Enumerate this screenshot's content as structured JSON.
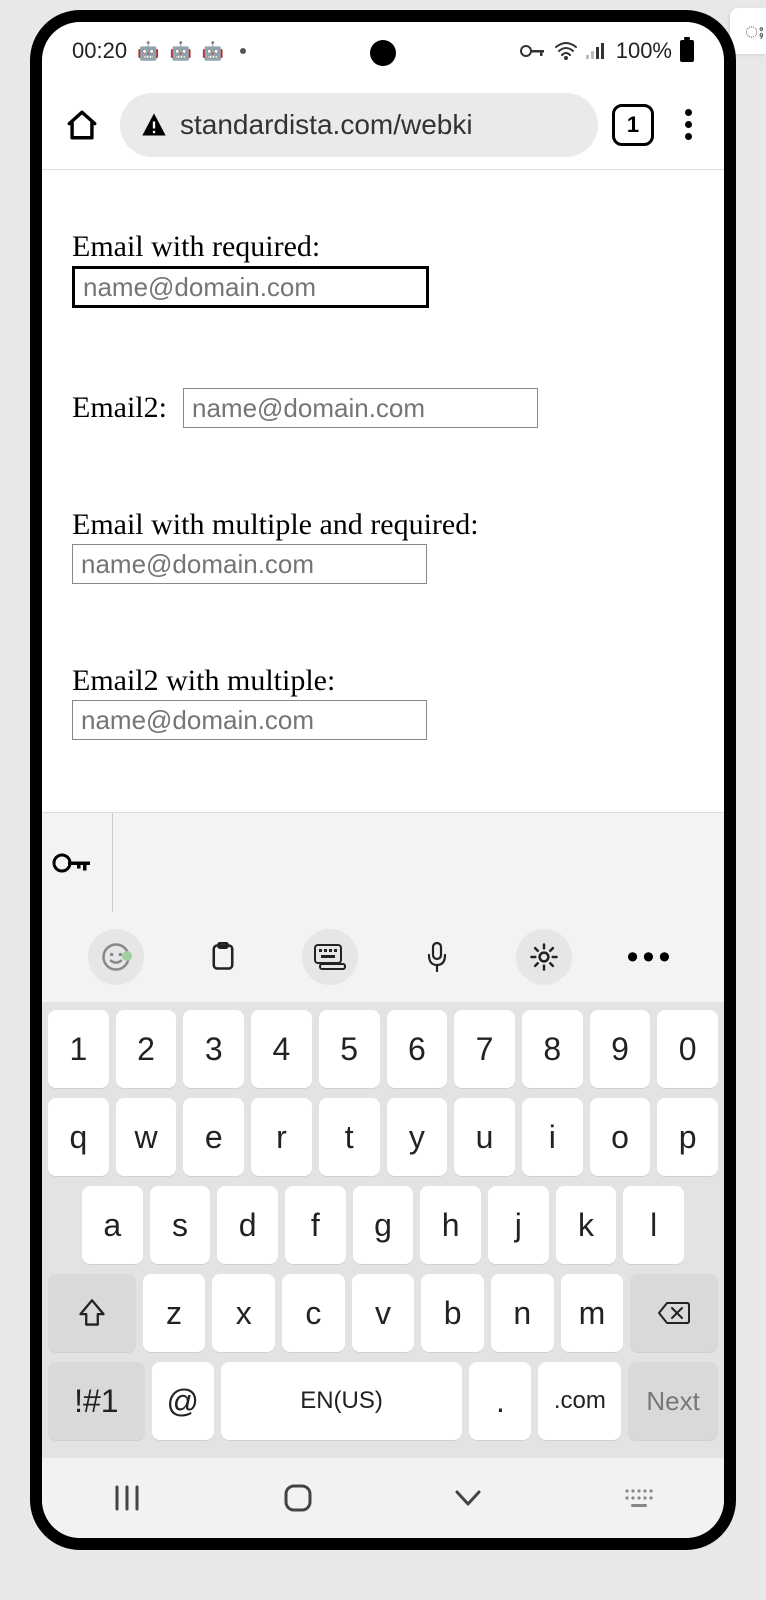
{
  "status": {
    "time": "00:20",
    "battery_pct": "100%"
  },
  "browser": {
    "url_visible": "standardista.com/webki",
    "tab_count": "1"
  },
  "form": {
    "fields": [
      {
        "label": "Email with required:",
        "placeholder": "name@domain.com",
        "focused": true,
        "layout": "block"
      },
      {
        "label": "Email2:",
        "placeholder": "name@domain.com",
        "focused": false,
        "layout": "inline"
      },
      {
        "label": "Email with multiple and required:",
        "placeholder": "name@domain.com",
        "focused": false,
        "layout": "block"
      },
      {
        "label": "Email2 with multiple:",
        "placeholder": "name@domain.com",
        "focused": false,
        "layout": "block"
      }
    ]
  },
  "keyboard": {
    "rows": {
      "numbers": [
        "1",
        "2",
        "3",
        "4",
        "5",
        "6",
        "7",
        "8",
        "9",
        "0"
      ],
      "qwerty": [
        "q",
        "w",
        "e",
        "r",
        "t",
        "y",
        "u",
        "i",
        "o",
        "p"
      ],
      "asdf": [
        "a",
        "s",
        "d",
        "f",
        "g",
        "h",
        "j",
        "k",
        "l"
      ],
      "zxcv": [
        "z",
        "x",
        "c",
        "v",
        "b",
        "n",
        "m"
      ]
    },
    "symbol_key": "!#1",
    "at_key": "@",
    "space_label": "EN(US)",
    "period_key": ".",
    "dotcom_key": ".com",
    "action_key": "Next"
  }
}
